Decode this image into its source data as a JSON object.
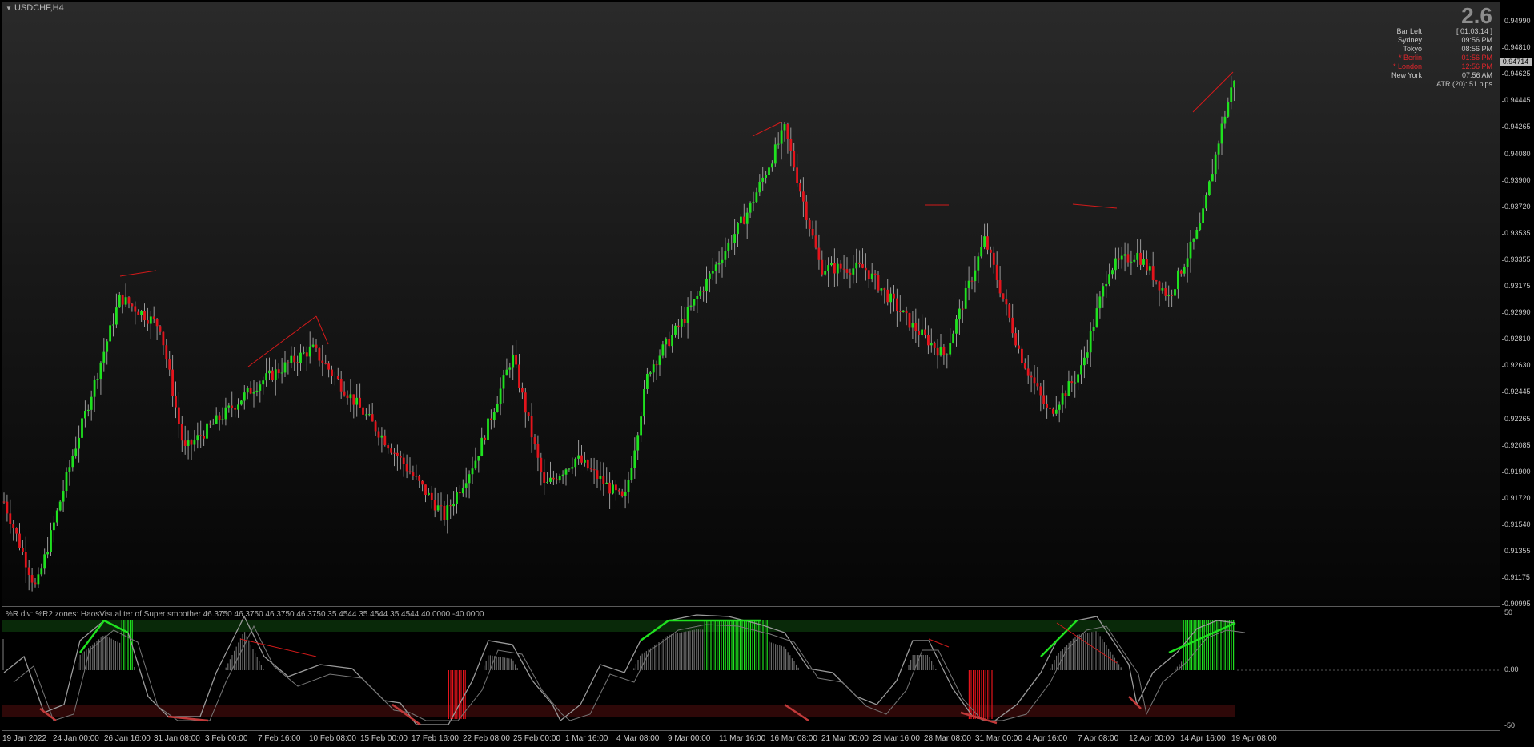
{
  "window": {
    "symbol_label": "USDCHF,H4"
  },
  "info_panel": {
    "spread": "2.6",
    "rows": [
      {
        "label": "Bar Left",
        "value": "[ 01:03:14 ]",
        "highlight": false
      },
      {
        "label": "Sydney",
        "value": "09:56 PM",
        "highlight": false
      },
      {
        "label": "Tokyo",
        "value": "08:56 PM",
        "highlight": false
      },
      {
        "label": "* Berlin",
        "value": "01:56 PM",
        "highlight": true
      },
      {
        "label": "* London",
        "value": "12:56 PM",
        "highlight": true
      },
      {
        "label": "New York",
        "value": "07:56 AM",
        "highlight": false
      }
    ],
    "atr": "ATR (20): 51 pips"
  },
  "price_axis": {
    "ticks": [
      "0.94990",
      "0.94810",
      "0.94625",
      "0.94445",
      "0.94265",
      "0.94080",
      "0.93900",
      "0.93720",
      "0.93535",
      "0.93355",
      "0.93175",
      "0.92990",
      "0.92810",
      "0.92630",
      "0.92445",
      "0.92265",
      "0.92085",
      "0.91900",
      "0.91720",
      "0.91540",
      "0.91355",
      "0.91175",
      "0.90995"
    ],
    "current_price": "0.94714"
  },
  "indicator": {
    "title": "%R div: %R2 zones:  HaosVisual  ter of Super smoother 46.3750 46.3750 46.3750 46.3750 35.4544 35.4544 35.4544 40.0000 -40.0000",
    "levels": [
      "50",
      "0.00",
      "-50"
    ]
  },
  "time_axis": {
    "labels": [
      "19 Jan 2022",
      "24 Jan 00:00",
      "26 Jan 16:00",
      "31 Jan 08:00",
      "3 Feb 00:00",
      "7 Feb 16:00",
      "10 Feb 08:00",
      "15 Feb 00:00",
      "17 Feb 16:00",
      "22 Feb 08:00",
      "25 Feb 00:00",
      "1 Mar 16:00",
      "4 Mar 08:00",
      "9 Mar 00:00",
      "11 Mar 16:00",
      "16 Mar 08:00",
      "21 Mar 00:00",
      "23 Mar 16:00",
      "28 Mar 08:00",
      "31 Mar 00:00",
      "4 Apr 16:00",
      "7 Apr 08:00",
      "12 Apr 00:00",
      "14 Apr 16:00",
      "19 Apr 08:00"
    ]
  },
  "colors": {
    "bull": "#1fe11f",
    "bear": "#e3141c",
    "osc_fill": "#8a8a8a"
  },
  "chart_data": {
    "type": "candlestick",
    "close_path_anchors": [
      [
        "19 Jan 2022",
        0.917
      ],
      [
        "21 Jan",
        0.911
      ],
      [
        "24 Jan",
        0.92
      ],
      [
        "26 Jan",
        0.931
      ],
      [
        "28 Jan",
        0.929
      ],
      [
        "1 Feb",
        0.9205
      ],
      [
        "3 Feb",
        0.9235
      ],
      [
        "7 Feb",
        0.925
      ],
      [
        "10 Feb",
        0.9275
      ],
      [
        "15 Feb",
        0.922
      ],
      [
        "17 Feb",
        0.916
      ],
      [
        "22 Feb",
        0.92
      ],
      [
        "23 Feb",
        0.927
      ],
      [
        "25 Feb",
        0.918
      ],
      [
        "1 Mar",
        0.92
      ],
      [
        "4 Mar",
        0.917
      ],
      [
        "7 Mar",
        0.926
      ],
      [
        "9 Mar",
        0.93
      ],
      [
        "11 Mar",
        0.937
      ],
      [
        "16 Mar",
        0.9425
      ],
      [
        "18 Mar",
        0.933
      ],
      [
        "21 Mar",
        0.933
      ],
      [
        "23 Mar",
        0.929
      ],
      [
        "24 Mar",
        0.927
      ],
      [
        "28 Mar",
        0.935
      ],
      [
        "30 Mar",
        0.927
      ],
      [
        "31 Mar",
        0.923
      ],
      [
        "4 Apr",
        0.926
      ],
      [
        "6 Apr",
        0.933
      ],
      [
        "8 Apr",
        0.934
      ],
      [
        "12 Apr",
        0.931
      ],
      [
        "14 Apr",
        0.936
      ],
      [
        "15 Apr",
        0.9425
      ],
      [
        "19 Apr",
        0.9468
      ]
    ]
  }
}
